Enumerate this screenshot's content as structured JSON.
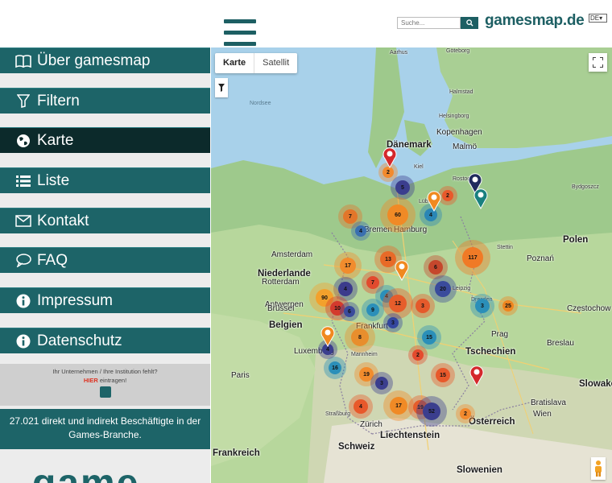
{
  "header": {
    "search_placeholder": "Suche...",
    "brand": "gamesmap.de",
    "language": "DE"
  },
  "sidebar": {
    "items": [
      {
        "label": "Über gamesmap",
        "icon": "book-icon",
        "active": false
      },
      {
        "label": "Filtern",
        "icon": "filter-icon",
        "active": false
      },
      {
        "label": "Karte",
        "icon": "globe-icon",
        "active": true
      },
      {
        "label": "Liste",
        "icon": "list-icon",
        "active": false
      },
      {
        "label": "Kontakt",
        "icon": "envelope-icon",
        "active": false
      },
      {
        "label": "FAQ",
        "icon": "speech-bubble-icon",
        "active": false
      },
      {
        "label": "Impressum",
        "icon": "info-icon",
        "active": false
      },
      {
        "label": "Datenschutz",
        "icon": "info-icon",
        "active": false
      }
    ],
    "promo": {
      "line1": "Ihr Unternehmen / Ihre Institution fehlt?",
      "here": "HIER",
      "line2_rest": " eintragen!"
    },
    "stat_text": "27.021 direkt und indirekt Beschäftigte in der Games-Branche.",
    "bottom_logo": "game"
  },
  "map": {
    "type_buttons": [
      "Karte",
      "Satellit"
    ],
    "selected_type": "Karte",
    "labels": [
      {
        "text": "Dänemark",
        "cls": "big"
      },
      {
        "text": "Niederlande",
        "cls": "big"
      },
      {
        "text": "Belgien",
        "cls": "big"
      },
      {
        "text": "Luxemburg",
        "cls": ""
      },
      {
        "text": "Tschechien",
        "cls": "big"
      },
      {
        "text": "Polen",
        "cls": "big"
      },
      {
        "text": "Österreich",
        "cls": "big"
      },
      {
        "text": "Schweiz",
        "cls": "big"
      },
      {
        "text": "Liechtenstein",
        "cls": "big"
      },
      {
        "text": "Frankreich",
        "cls": "big"
      },
      {
        "text": "Slowenien",
        "cls": "big"
      },
      {
        "text": "Slowakei",
        "cls": "big"
      },
      {
        "text": "Kopenhagen",
        "cls": ""
      },
      {
        "text": "Malmö",
        "cls": ""
      },
      {
        "text": "Göteborg",
        "cls": "sm"
      },
      {
        "text": "Halmstad",
        "cls": "sm"
      },
      {
        "text": "Helsingborg",
        "cls": "sm"
      },
      {
        "text": "Hamburg",
        "cls": ""
      },
      {
        "text": "Bremen",
        "cls": ""
      },
      {
        "text": "Amsterdam",
        "cls": ""
      },
      {
        "text": "Rotterdam",
        "cls": ""
      },
      {
        "text": "Antwerpen",
        "cls": ""
      },
      {
        "text": "Brüssel",
        "cls": ""
      },
      {
        "text": "Frankfurt",
        "cls": ""
      },
      {
        "text": "Prag",
        "cls": ""
      },
      {
        "text": "Breslau",
        "cls": ""
      },
      {
        "text": "Poznań",
        "cls": ""
      },
      {
        "text": "Bratislava",
        "cls": ""
      },
      {
        "text": "Wien",
        "cls": ""
      },
      {
        "text": "Zürich",
        "cls": ""
      },
      {
        "text": "Paris",
        "cls": ""
      },
      {
        "text": "Straßburg",
        "cls": "sm"
      },
      {
        "text": "Częstochow",
        "cls": ""
      },
      {
        "text": "Aarhus",
        "cls": "sm"
      },
      {
        "text": "Nordsee",
        "cls": "sea"
      },
      {
        "text": "Stettin",
        "cls": "sm"
      },
      {
        "text": "Lübeck",
        "cls": "sm"
      },
      {
        "text": "Rostock",
        "cls": "sm"
      },
      {
        "text": "Kiel",
        "cls": "sm"
      },
      {
        "text": "Bydgoszcz",
        "cls": "sm"
      },
      {
        "text": "Leipzig",
        "cls": "sm"
      },
      {
        "text": "Dresden",
        "cls": "sm"
      },
      {
        "text": "Mannheim",
        "cls": "sm"
      }
    ],
    "clusters": [
      {
        "n": "2",
        "color": "#f28a2e"
      },
      {
        "n": "5",
        "color": "#3b3e8e"
      },
      {
        "n": "2",
        "color": "#e8592b"
      },
      {
        "n": "4",
        "color": "#2a86b5"
      },
      {
        "n": "60",
        "color": "#f08a26"
      },
      {
        "n": "7",
        "color": "#e2762a"
      },
      {
        "n": "4",
        "color": "#3a6fb0"
      },
      {
        "n": "17",
        "color": "#f18c2d"
      },
      {
        "n": "13",
        "color": "#e86a28"
      },
      {
        "n": "6",
        "color": "#c5472c"
      },
      {
        "n": "117",
        "color": "#f07a26"
      },
      {
        "n": "7",
        "color": "#e24a2e"
      },
      {
        "n": "4",
        "color": "#3c3b8c"
      },
      {
        "n": "4",
        "color": "#2b8fb9"
      },
      {
        "n": "20",
        "color": "#3a4b9c"
      },
      {
        "n": "90",
        "color": "#f3a12c"
      },
      {
        "n": "10",
        "color": "#d43a2d"
      },
      {
        "n": "6",
        "color": "#3a4b9c"
      },
      {
        "n": "9",
        "color": "#2b8fb9"
      },
      {
        "n": "12",
        "color": "#e65d2b"
      },
      {
        "n": "3",
        "color": "#e55a2b"
      },
      {
        "n": "3",
        "color": "#2b8fb9"
      },
      {
        "n": "25",
        "color": "#f0851f"
      },
      {
        "n": "8",
        "color": "#e88e2d"
      },
      {
        "n": "3",
        "color": "#34469e"
      },
      {
        "n": "15",
        "color": "#2b8fb9"
      },
      {
        "n": "2",
        "color": "#e44a2e"
      },
      {
        "n": "16",
        "color": "#2b8fb9"
      },
      {
        "n": "4",
        "color": "#3b3e8e"
      },
      {
        "n": "15",
        "color": "#e8592b"
      },
      {
        "n": "19",
        "color": "#f18c2d"
      },
      {
        "n": "3",
        "color": "#3b3e8e"
      },
      {
        "n": "4",
        "color": "#e8592b"
      },
      {
        "n": "17",
        "color": "#f08a26"
      },
      {
        "n": "19",
        "color": "#e65d2b"
      },
      {
        "n": "52",
        "color": "#3b3e8e"
      },
      {
        "n": "2",
        "color": "#f28a2e"
      }
    ],
    "markers": [
      {
        "icon": "red-pin-icon",
        "color": "#d4282c"
      },
      {
        "icon": "orange-pin-icon",
        "color": "#f0891f"
      },
      {
        "icon": "navy-pin-icon",
        "color": "#1f2b5c"
      },
      {
        "icon": "teal-pin-icon",
        "color": "#19807f"
      },
      {
        "icon": "orange-pin-icon",
        "color": "#f0891f"
      },
      {
        "icon": "orange-pin-icon",
        "color": "#f0891f"
      },
      {
        "icon": "red-pin-icon",
        "color": "#d4282c"
      }
    ]
  },
  "colors": {
    "accent": "#1d6468",
    "active": "#0c2a2b",
    "brand": "#1d5f63"
  }
}
